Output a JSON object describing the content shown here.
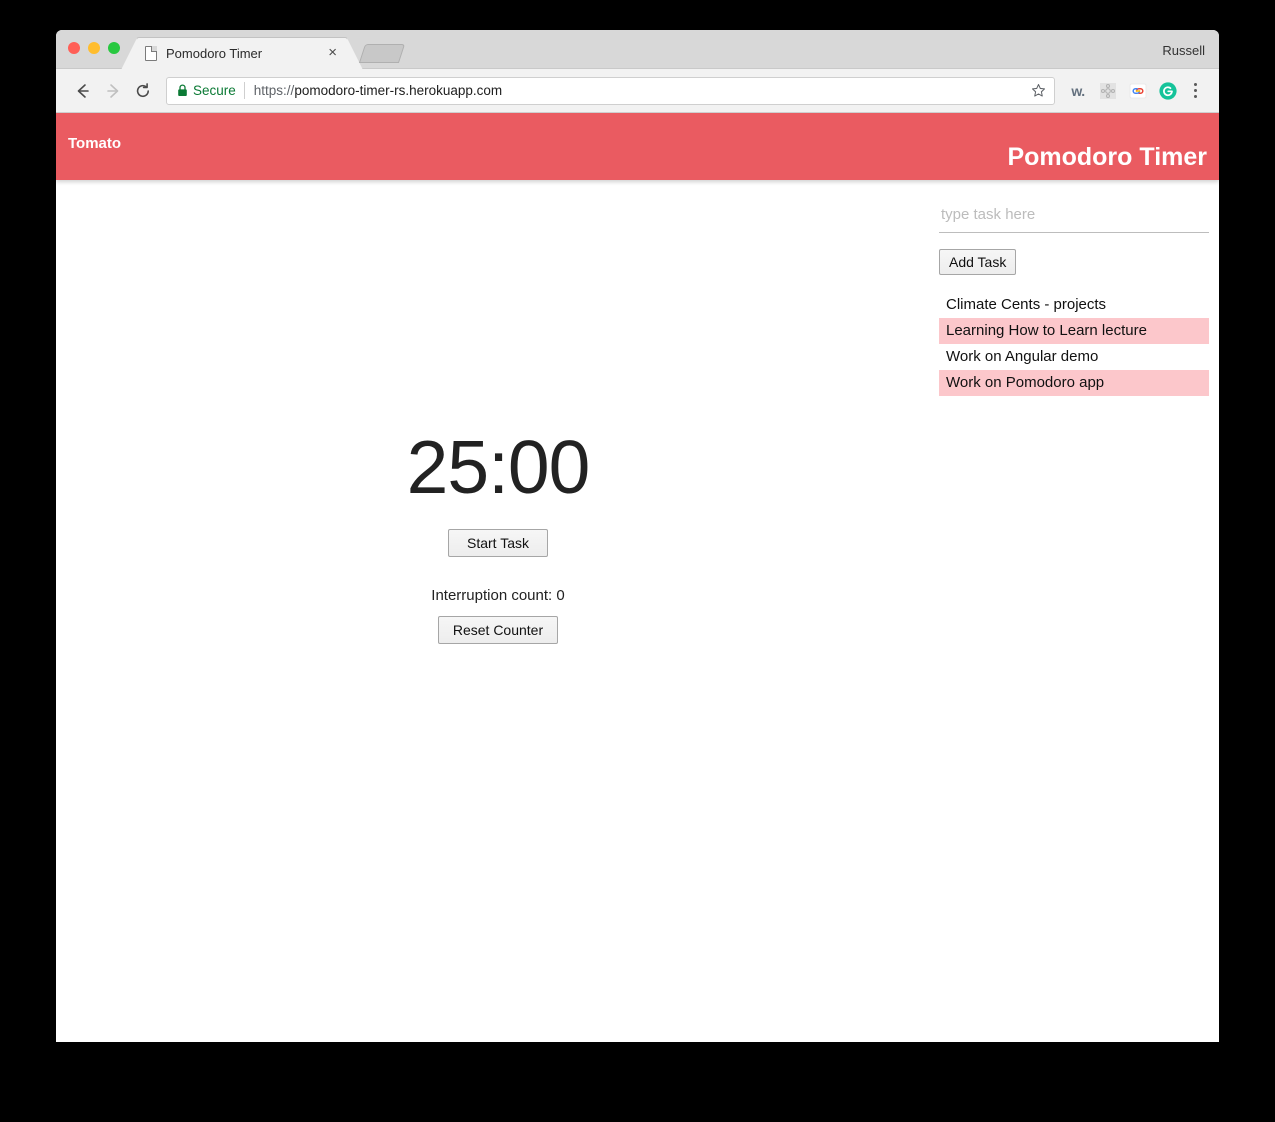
{
  "window": {
    "user_label": "Russell",
    "traffic_lights": [
      "close-red",
      "minimize-yellow",
      "maximize-green"
    ]
  },
  "tab": {
    "title": "Pomodoro Timer",
    "favicon": "document-icon",
    "close_label": "×",
    "new_tab_label": "+"
  },
  "toolbar": {
    "back_label": "Back",
    "forward_label": "Forward",
    "reload_label": "Reload",
    "security_label": "Secure",
    "url_scheme": "https://",
    "url_host": "pomodoro-timer-rs.herokuapp.com",
    "bookmark_label": "Bookmark this page",
    "extensions": [
      {
        "name": "wikiwand-extension-icon",
        "glyph": "w."
      },
      {
        "name": "puzzle-extension-icon",
        "glyph": ""
      },
      {
        "name": "google-link-extension-icon",
        "glyph": ""
      },
      {
        "name": "grammarly-extension-icon",
        "glyph": "G"
      }
    ],
    "menu_label": "Customize and control"
  },
  "app": {
    "brand": "Tomato",
    "navbar_title": "Pomodoro Timer",
    "navbar_color": "#ea5b61"
  },
  "tasks": {
    "input_placeholder": "type task here",
    "input_value": "",
    "add_button_label": "Add Task",
    "completed_highlight_color": "#fcc7cb",
    "items": [
      {
        "label": "Climate Cents - projects",
        "done": false
      },
      {
        "label": "Learning How to Learn lecture",
        "done": true
      },
      {
        "label": "Work on Angular demo",
        "done": false
      },
      {
        "label": "Work on Pomodoro app",
        "done": true
      }
    ]
  },
  "timer": {
    "display": "25:00",
    "start_button_label": "Start Task",
    "interruption_text": "Interruption count: 0",
    "reset_button_label": "Reset Counter"
  }
}
